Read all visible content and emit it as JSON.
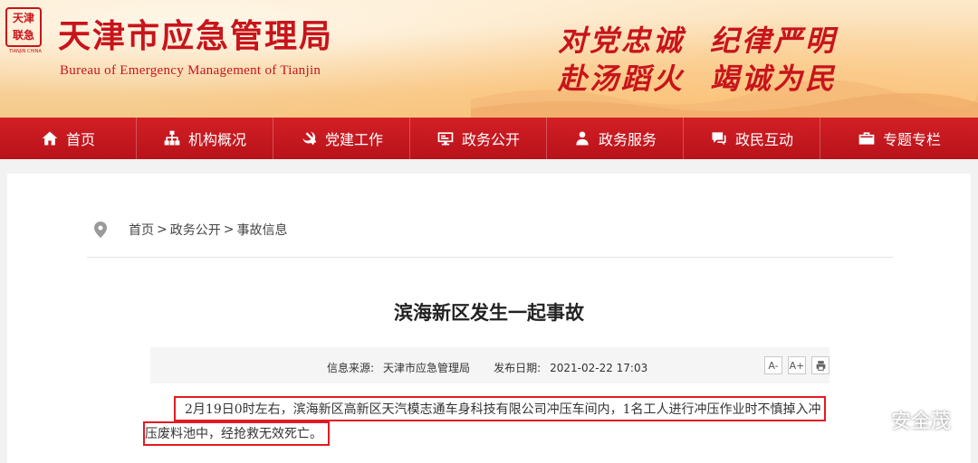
{
  "header": {
    "seal_text": [
      "天",
      "津",
      "联",
      "急"
    ],
    "seal_caption": "TIANJIN CHINA",
    "title": "天津市应急管理局",
    "subtitle": "Bureau  of  Emergency  Management  of  Tianjin",
    "slogan_line1_a": "对党忠诚",
    "slogan_line1_b": "纪律严明",
    "slogan_line2_a": "赴汤蹈火",
    "slogan_line2_b": "竭诚为民"
  },
  "nav": [
    {
      "label": "首页",
      "icon": "home-icon"
    },
    {
      "label": "机构概况",
      "icon": "org-chart-icon"
    },
    {
      "label": "党建工作",
      "icon": "party-emblem-icon"
    },
    {
      "label": "政务公开",
      "icon": "monitor-icon"
    },
    {
      "label": "政务服务",
      "icon": "person-icon"
    },
    {
      "label": "政民互动",
      "icon": "chat-icon"
    },
    {
      "label": "专题专栏",
      "icon": "briefcase-icon"
    }
  ],
  "breadcrumb": {
    "home": "首页",
    "section": "政务公开",
    "current": "事故信息",
    "separator": ">"
  },
  "article": {
    "title": "滨海新区发生一起事故",
    "source_label": "信息来源:",
    "source": "天津市应急管理局",
    "date_label": "发布日期:",
    "date": "2021-02-22 17:03",
    "body": "2月19日0时左右，滨海新区高新区天汽模志通车身科技有限公司冲压车间内，1名工人进行冲压作业时不慎掉入冲压废料池中，经抢救无效死亡。"
  },
  "tools": {
    "font_smaller": "A-",
    "font_larger": "A+",
    "print": "print-icon"
  },
  "watermark": "安全茂",
  "colors": {
    "brand_red": "#c8141b",
    "nav_red": "#c8141b",
    "highlight_red": "#e21b22"
  }
}
